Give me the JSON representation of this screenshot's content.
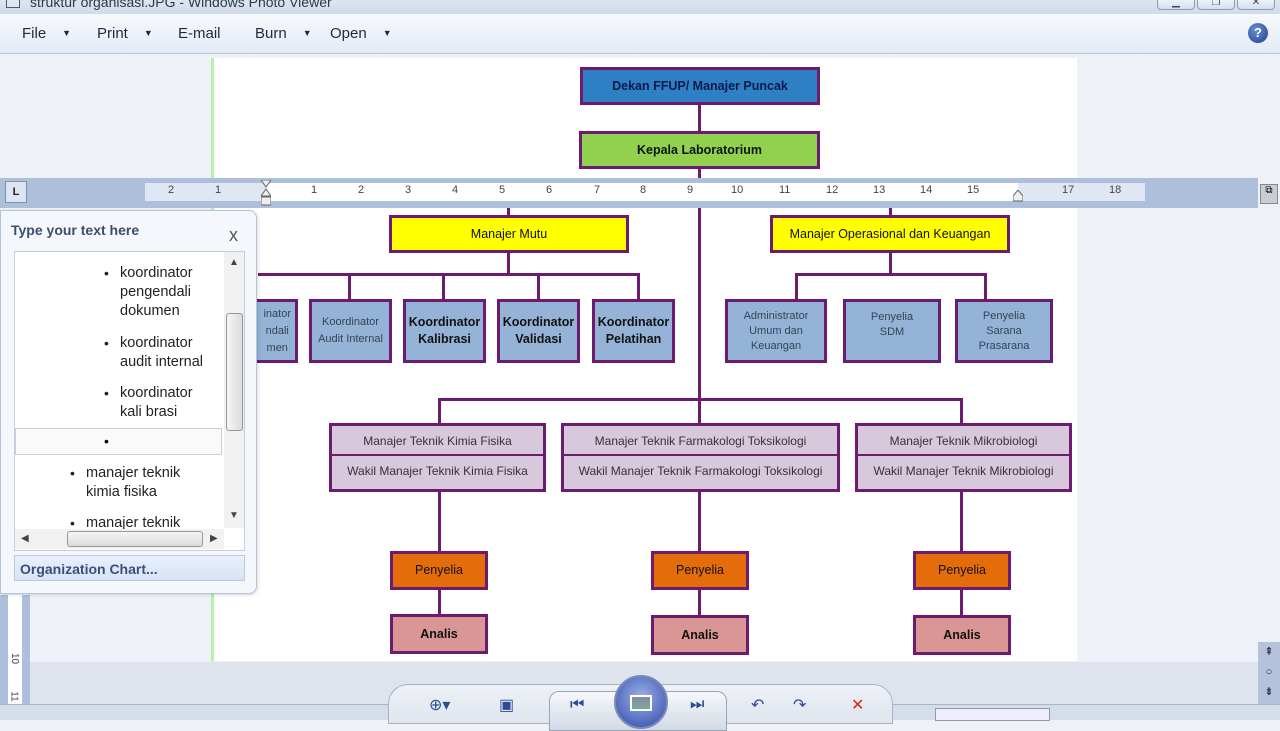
{
  "window": {
    "title": "struktur organisasi.JPG - Windows Photo Viewer",
    "controls": [
      "minimize",
      "maximize",
      "close"
    ]
  },
  "menu": {
    "items": [
      {
        "label": "File",
        "has_dropdown": true
      },
      {
        "label": "Print",
        "has_dropdown": true
      },
      {
        "label": "E-mail",
        "has_dropdown": false
      },
      {
        "label": "Burn",
        "has_dropdown": true
      },
      {
        "label": "Open",
        "has_dropdown": true
      }
    ],
    "help_icon": "?"
  },
  "ruler": {
    "tab_selector": "L",
    "ticks": [
      "2",
      "1",
      "1",
      "2",
      "3",
      "4",
      "5",
      "6",
      "7",
      "8",
      "9",
      "10",
      "11",
      "12",
      "13",
      "14",
      "15",
      "17",
      "18"
    ],
    "vertical_ticks": [
      "10",
      "11"
    ]
  },
  "text_pane": {
    "title": "Type your text here",
    "close_label": "x",
    "items": [
      {
        "text": "koordinator\npengendali\ndokumen",
        "level": 3
      },
      {
        "text": "koordinator\naudit internal",
        "level": 3
      },
      {
        "text": "koordinator\nkali brasi",
        "level": 3
      },
      {
        "text": "",
        "level": 3
      },
      {
        "text": "manajer teknik\nkimia fisika",
        "level": 2
      },
      {
        "text": "manajer teknik",
        "level": 2
      }
    ],
    "footer_link": "Organization Chart..."
  },
  "org_chart": {
    "colors": {
      "border": "#6d1b6f",
      "top": "#2e7fc4",
      "head": "#92d050",
      "manager": "#ffff00",
      "coordinator": "#95b3d7",
      "technical": "#d7c8dc",
      "supervisor": "#e46c0a",
      "analyst": "#d99694"
    },
    "top": "Dekan FFUP/ Manajer Puncak",
    "head": "Kepala Laboratorium",
    "quality_manager": "Manajer Mutu",
    "quality_coordinators": [
      "Koordinator Pengendali Dokumen",
      "Koordinator Audit Internal",
      "Koordinator Kalibrasi",
      "Koordinator Validasi",
      "Koordinator Pelatihan"
    ],
    "quality_coordinators_visible": [
      "inator\nndali\nmen",
      "Koordinator\nAudit Internal",
      "Koordinator\nKalibrasi",
      "Koordinator\nValidasi",
      "Koordinator\nPelatihan"
    ],
    "ops_manager": "Manajer Operasional dan Keuangan",
    "ops_staff": [
      "Administrator\nUmum dan\nKeuangan",
      "Penyelia\nSDM",
      "Penyelia\nSarana\nPrasarana"
    ],
    "technical": [
      {
        "manager": "Manajer Teknik  Kimia Fisika",
        "deputy": "Wakil Manajer Teknik Kimia Fisika",
        "supervisor": "Penyelia",
        "analyst": "Analis"
      },
      {
        "manager": "Manajer Teknik  Farmakologi Toksikologi",
        "deputy": "Wakil Manajer Teknik Farmakologi Toksikologi",
        "supervisor": "Penyelia",
        "analyst": "Analis"
      },
      {
        "manager": "Manajer Teknik  Mikrobiologi",
        "deputy": "Wakil Manajer Teknik Mikrobiologi",
        "supervisor": "Penyelia",
        "analyst": "Analis"
      }
    ]
  },
  "photo_toolbar": {
    "buttons": [
      "zoom",
      "actual-size",
      "previous",
      "slideshow",
      "next",
      "rotate-counterclockwise",
      "rotate-clockwise",
      "delete"
    ]
  }
}
